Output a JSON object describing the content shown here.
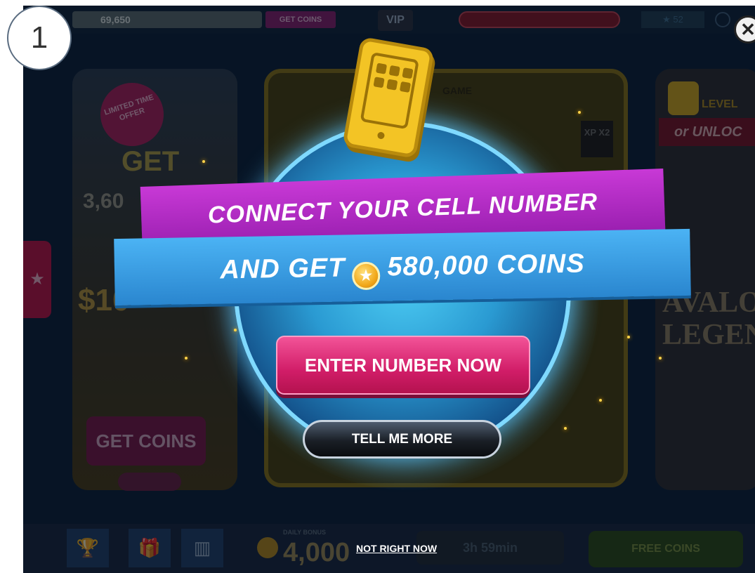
{
  "step_number": "1",
  "top_bar": {
    "coin_balance": "69,650",
    "get_coins_label": "GET COINS",
    "vip_label": "VIP",
    "star_count": "52"
  },
  "background": {
    "left_card": {
      "badge": "LIMITED TIME OFFER",
      "get": "GET",
      "amount": "3,60",
      "price": "$10",
      "button": "GET COINS"
    },
    "middle_card": {
      "title": "GAME",
      "xp_badge": "XP X2"
    },
    "right_card": {
      "level_label": "LEVEL",
      "unlock_label": "or UNLOC",
      "title": "AVALON LEGEN"
    },
    "bottom_bar": {
      "daily_bonus_label": "DAILY BONUS",
      "daily_bonus_amount": "4,000",
      "timer": "3h 59min",
      "free_coins": "FREE COINS"
    }
  },
  "modal": {
    "headline": "CONNECT YOUR CELL NUMBER",
    "subline_prefix": "AND GET",
    "subline_amount": "580,000 COINS",
    "primary_button": "ENTER NUMBER NOW",
    "secondary_button": "TELL ME MORE",
    "dismiss_link": "NOT RIGHT NOW",
    "close_glyph": "✕"
  },
  "icons": {
    "close": "close-icon",
    "phone": "phone-icon",
    "coin": "coin-icon",
    "trophy": "trophy-icon",
    "gift": "gift-icon",
    "leaderboard": "leaderboard-icon",
    "lock": "lock-icon",
    "star": "star-icon"
  },
  "colors": {
    "purple_banner": "#b02cc4",
    "blue_banner": "#3aa0e6",
    "primary_button": "#d11d68",
    "glow": "#5ec8ff"
  }
}
